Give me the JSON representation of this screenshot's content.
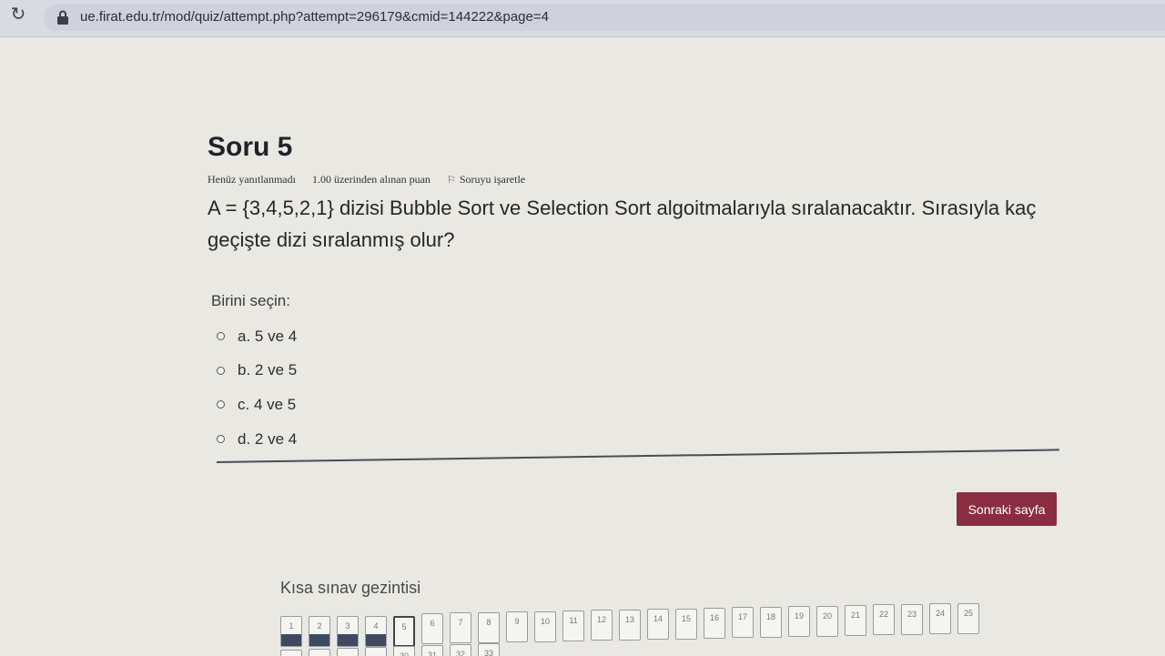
{
  "browser": {
    "url": "ue.firat.edu.tr/mod/quiz/attempt.php?attempt=296179&cmid=144222&page=4",
    "reload_icon": "reload-icon",
    "lock_icon": "lock-icon"
  },
  "question": {
    "title": "Soru 5",
    "status": "Henüz yanıtlanmadı",
    "points": "1.00 üzerinden alınan puan",
    "flag_label": "Soruyu işaretle",
    "text": "A = {3,4,5,2,1} dizisi Bubble Sort ve Selection Sort algoitmalarıyla sıralanacaktır. Sırasıyla kaç geçişte dizi sıralanmış olur?",
    "prompt": "Birini seçin:",
    "options": [
      {
        "label": "a. 5 ve 4"
      },
      {
        "label": "b. 2 ve 5"
      },
      {
        "label": "c. 4 ve 5"
      },
      {
        "label": "d. 2 ve 4"
      }
    ]
  },
  "next_button": "Sonraki sayfa",
  "navigation": {
    "title": "Kısa sınav gezintisi",
    "buttons": [
      {
        "n": "1",
        "answered": true
      },
      {
        "n": "2",
        "answered": true
      },
      {
        "n": "3",
        "answered": true
      },
      {
        "n": "4",
        "answered": true
      },
      {
        "n": "5",
        "answered": false,
        "current": true
      },
      {
        "n": "6"
      },
      {
        "n": "7"
      },
      {
        "n": "8"
      },
      {
        "n": "9"
      },
      {
        "n": "10"
      },
      {
        "n": "11"
      },
      {
        "n": "12"
      },
      {
        "n": "13"
      },
      {
        "n": "14"
      },
      {
        "n": "15"
      },
      {
        "n": "16"
      },
      {
        "n": "17"
      },
      {
        "n": "18"
      },
      {
        "n": "19"
      },
      {
        "n": "20"
      },
      {
        "n": "21"
      },
      {
        "n": "22"
      },
      {
        "n": "23"
      },
      {
        "n": "24"
      },
      {
        "n": "25"
      }
    ],
    "row2": [
      "",
      "",
      "",
      "",
      "30",
      "31",
      "32",
      "33"
    ]
  },
  "colors": {
    "accent": "#8a2d42",
    "answered": "#3f4a62"
  }
}
